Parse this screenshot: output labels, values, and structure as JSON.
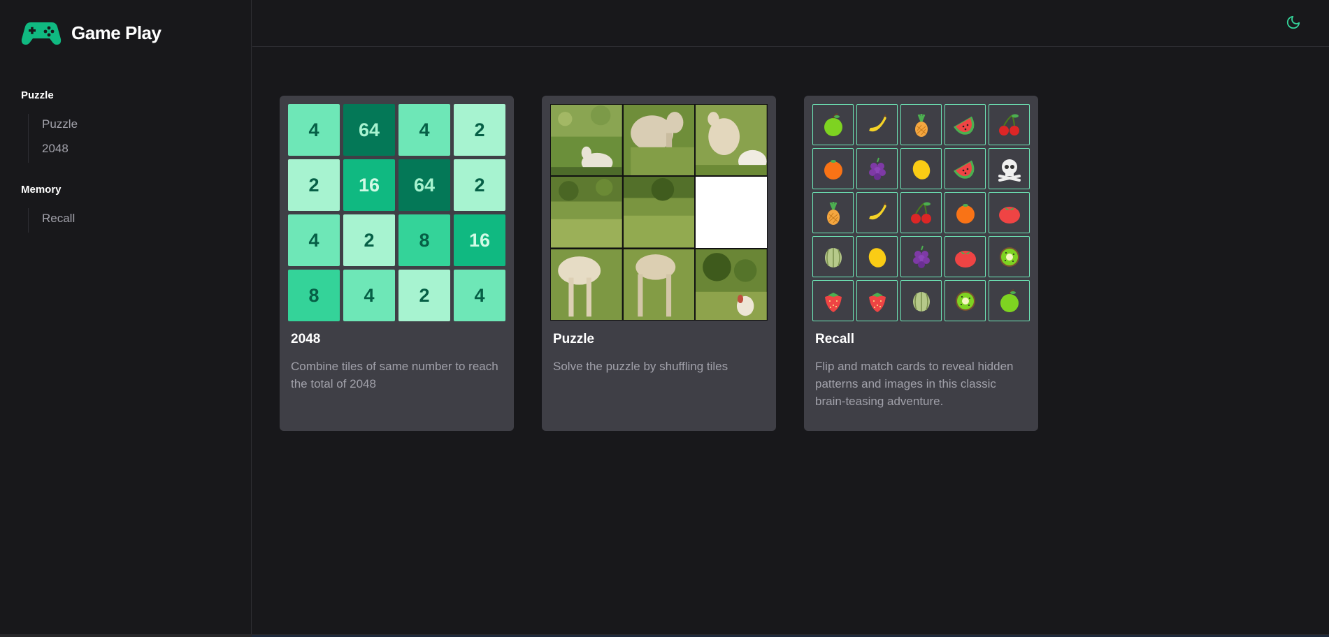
{
  "app": {
    "title": "Game Play",
    "logo_icon": "gamepad-icon",
    "accent": "#10b981"
  },
  "sidebar": {
    "groups": [
      {
        "title": "Puzzle",
        "items": [
          {
            "label": "Puzzle"
          },
          {
            "label": "2048"
          }
        ]
      },
      {
        "title": "Memory",
        "items": [
          {
            "label": "Recall"
          }
        ]
      }
    ]
  },
  "header": {
    "theme_toggle_icon": "moon-icon"
  },
  "cards": [
    {
      "title": "2048",
      "description": "Combine tiles of same number to reach the total of 2048",
      "board": [
        [
          4,
          64,
          4,
          2
        ],
        [
          2,
          16,
          64,
          2
        ],
        [
          4,
          2,
          8,
          16
        ],
        [
          8,
          4,
          2,
          4
        ]
      ]
    },
    {
      "title": "Puzzle",
      "description": "Solve the puzzle by shuffling tiles",
      "image_subject": "goats on grassy meadow",
      "blank_tile": "row 2, column 3"
    },
    {
      "title": "Recall",
      "description": "Flip and match cards to reveal hidden patterns and images in this classic brain-teasing adventure.",
      "cards": [
        [
          "green-apple",
          "banana",
          "pineapple",
          "watermelon",
          "cherries"
        ],
        [
          "orange",
          "grapes",
          "lemon",
          "watermelon",
          "skull-crossbones"
        ],
        [
          "pineapple",
          "banana",
          "cherries",
          "orange",
          "tomato"
        ],
        [
          "melon",
          "lemon",
          "grapes",
          "tomato",
          "kiwi"
        ],
        [
          "strawberry",
          "strawberry",
          "melon",
          "kiwi",
          "green-apple"
        ]
      ]
    }
  ]
}
